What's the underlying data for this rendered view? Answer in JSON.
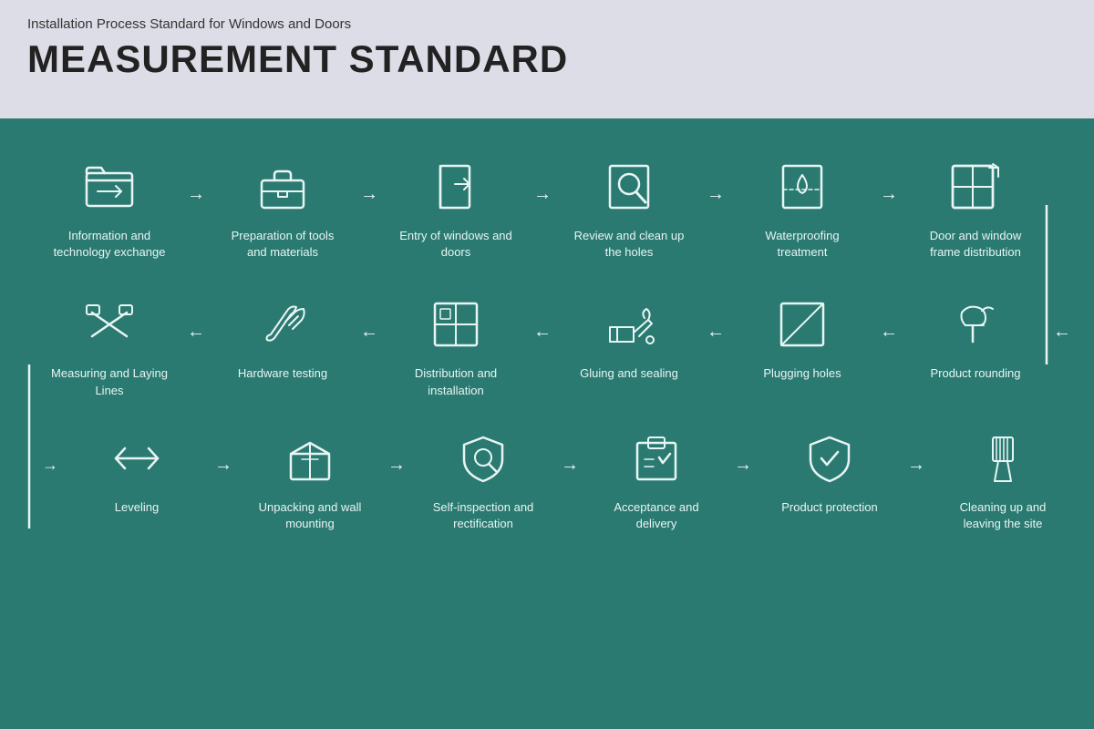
{
  "header": {
    "subtitle": "Installation Process Standard for Windows and Doors",
    "title": "MEASUREMENT STANDARD"
  },
  "colors": {
    "bg_main": "#2a7a72",
    "bg_header": "#dddde8",
    "icon_stroke": "#e8f5f3",
    "text": "#e8f5f3"
  },
  "row1": [
    {
      "id": "info-exchange",
      "label": "Information and technology exchange"
    },
    {
      "id": "tools-prep",
      "label": "Preparation of tools and materials"
    },
    {
      "id": "entry-windows",
      "label": "Entry of windows and doors"
    },
    {
      "id": "review-holes",
      "label": "Review and clean up the holes"
    },
    {
      "id": "waterproofing",
      "label": "Waterproofing treatment"
    },
    {
      "id": "frame-distribution",
      "label": "Door and window frame distribution"
    }
  ],
  "row2": [
    {
      "id": "measuring-lines",
      "label": "Measuring and Laying Lines"
    },
    {
      "id": "hardware-testing",
      "label": "Hardware testing"
    },
    {
      "id": "distribution-install",
      "label": "Distribution and installation"
    },
    {
      "id": "gluing-sealing",
      "label": "Gluing and sealing"
    },
    {
      "id": "plugging-holes",
      "label": "Plugging holes"
    },
    {
      "id": "product-rounding",
      "label": "Product rounding"
    }
  ],
  "row3": [
    {
      "id": "leveling",
      "label": "Leveling"
    },
    {
      "id": "unpacking-mount",
      "label": "Unpacking and wall mounting"
    },
    {
      "id": "self-inspection",
      "label": "Self-inspection and rectification"
    },
    {
      "id": "acceptance-delivery",
      "label": "Acceptance and delivery"
    },
    {
      "id": "product-protection",
      "label": "Product protection"
    },
    {
      "id": "cleaning-site",
      "label": "Cleaning up and leaving the site"
    }
  ]
}
